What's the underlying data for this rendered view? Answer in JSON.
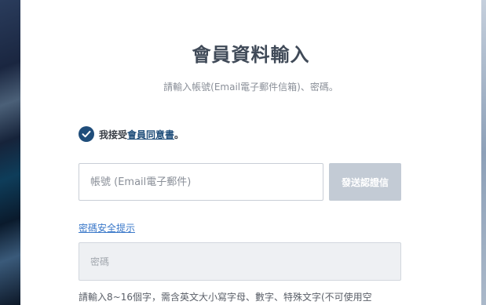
{
  "form": {
    "title": "會員資料輸入",
    "subtitle": "請輸入帳號(Email電子郵件信箱)、密碼。",
    "consent": {
      "prefix": "我接受",
      "link": "會員同意書",
      "suffix": "。",
      "checked": true
    },
    "email": {
      "placeholder": "帳號 (Email電子郵件)",
      "value": ""
    },
    "verify_button": "發送認證信",
    "password_tip_link": "密碼安全提示",
    "password": {
      "placeholder": "密碼",
      "value": ""
    },
    "password_hint": "請輸入8~16個字，需含英文大小寫字母、數字、特殊文字(不可使用空"
  },
  "colors": {
    "accent": "#1f4d7a",
    "link": "#3a78c9",
    "button_disabled": "#c3cbd5",
    "input_disabled_bg": "#eef0f3"
  }
}
